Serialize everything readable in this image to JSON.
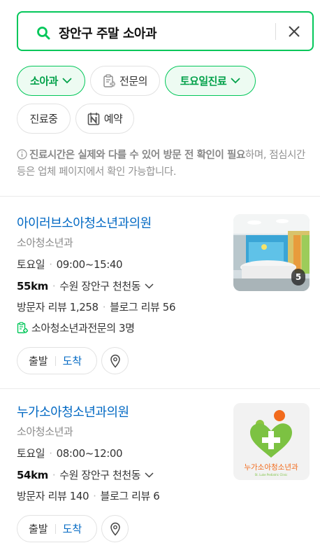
{
  "search": {
    "query": "장안구 주말 소아과"
  },
  "filters": [
    {
      "label": "소아과",
      "active": true,
      "has_chevron": true
    },
    {
      "label": "전문의",
      "active": false,
      "icon": "doctor-doc-icon"
    },
    {
      "label": "토요일진료",
      "active": true,
      "has_chevron": true
    },
    {
      "label": "진료중",
      "active": false
    },
    {
      "label": "예약",
      "active": false,
      "icon": "naver-n-icon"
    }
  ],
  "notice": {
    "bold": "진료시간은 실제와 다를 수 있어 방문 전 확인이 필요",
    "rest": "하며, 점심시간 등은 업체 페이지에서 확인 가능합니다."
  },
  "results": [
    {
      "name": "아이러브소아청소년과의원",
      "category": "소아청소년과",
      "day": "토요일",
      "hours": "09:00~15:40",
      "distance": "55km",
      "location": "수원 장안구 천천동",
      "visitor_reviews": "방문자 리뷰 1,258",
      "blog_reviews": "블로그 리뷰 56",
      "specialist": "소아청소년과전문의 3명",
      "photo_count": "5",
      "start_label": "출발",
      "arrive_label": "도착"
    },
    {
      "name": "누가소아청소년과의원",
      "category": "소아청소년과",
      "day": "토요일",
      "hours": "08:00~12:00",
      "distance": "54km",
      "location": "수원 장안구 천천동",
      "visitor_reviews": "방문자 리뷰 140",
      "blog_reviews": "블로그 리뷰 6",
      "logo_text": "누가소아청소년과",
      "logo_subtext": "St. Luke Pediatric Clinic",
      "start_label": "출발",
      "arrive_label": "도착"
    }
  ],
  "colors": {
    "accent": "#03c75a",
    "link": "#0068c3"
  }
}
